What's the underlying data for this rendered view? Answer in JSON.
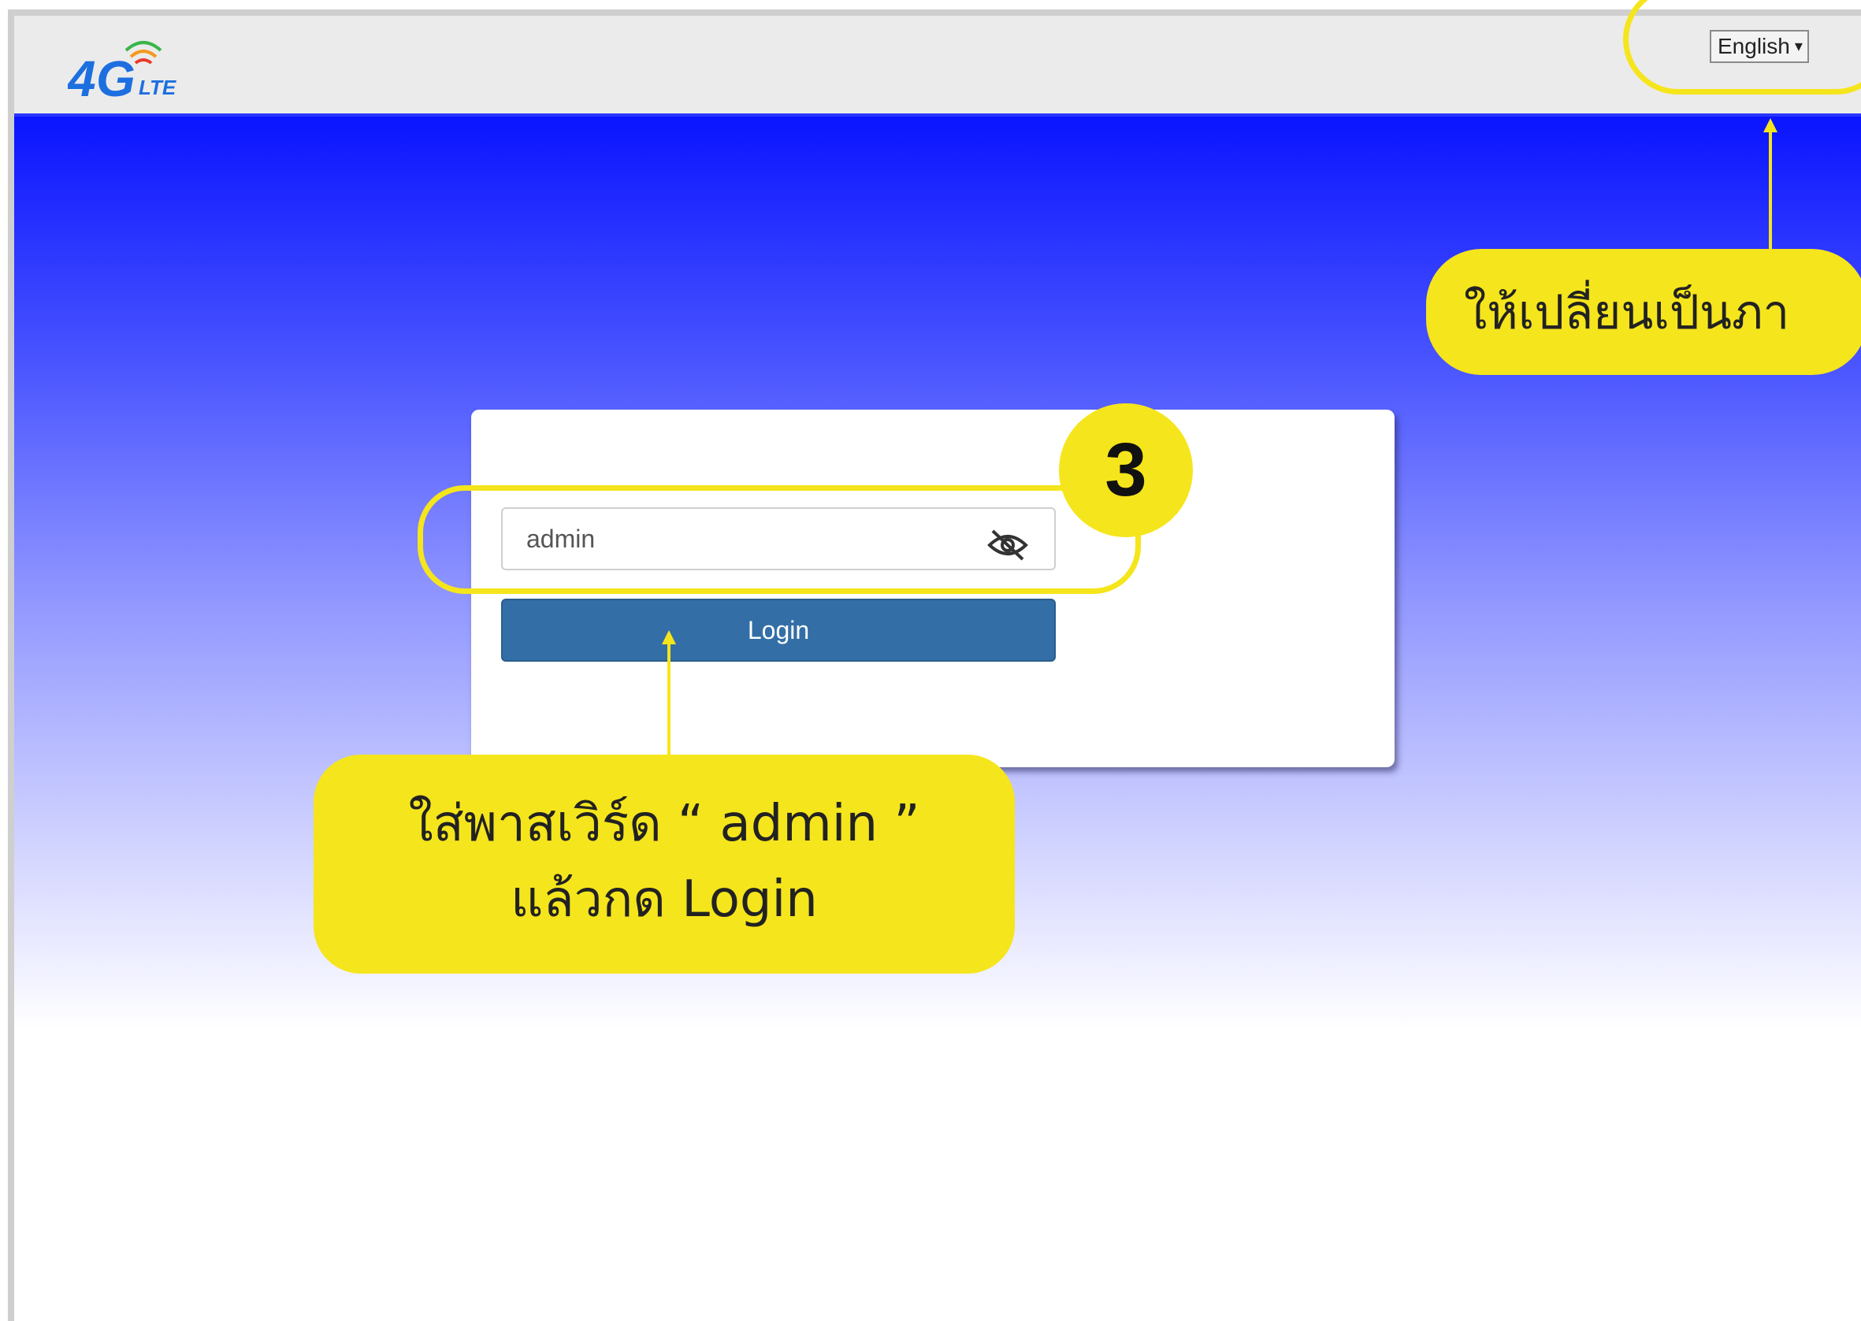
{
  "header": {
    "logo_alt": "4G LTE",
    "language_select": {
      "value": "English"
    }
  },
  "login": {
    "password_value": "admin",
    "login_label": "Login"
  },
  "annotations": {
    "step_badge": "3",
    "callout_login_line1": "ใส่พาสเวิร์ด “ admin ”",
    "callout_login_line2": "แล้วกด Login",
    "callout_language": "ให้เปลี่ยนเป็นภา"
  },
  "colors": {
    "accent_yellow": "#f5e51c",
    "button_blue": "#336fa6",
    "hero_top": "#0a14ff"
  }
}
